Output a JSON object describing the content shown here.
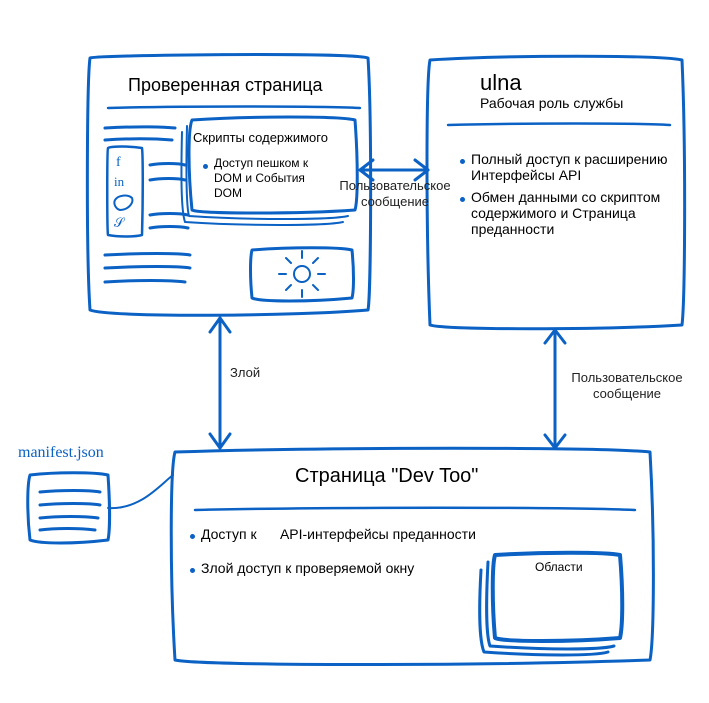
{
  "box1": {
    "title": "Проверенная страница",
    "inner_title": "Скрипты содержимого",
    "inner_bullet": "Доступ пешком к DOM и События DOM"
  },
  "box2": {
    "title": "ulna",
    "subtitle": "Рабочая роль службы",
    "bullets": [
      "Полный доступ к расширению Интерфейсы API",
      "Обмен данными со скриптом содержимого и Страница преданности"
    ]
  },
  "box3": {
    "title": "Страница \"Dev Too\"",
    "bullet1_a": "Доступ к",
    "bullet1_b": "API-интерфейсы преданности",
    "bullet2": "Злой доступ к проверяемой окну",
    "panels": "Области"
  },
  "edges": {
    "b1_b2_a": "Пользовательское",
    "b1_b2_b": "сообщение",
    "b2_b3_a": "Пользовательское",
    "b2_b3_b": "сообщение",
    "b1_b3": "Злой"
  },
  "manifest": "manifest.json"
}
